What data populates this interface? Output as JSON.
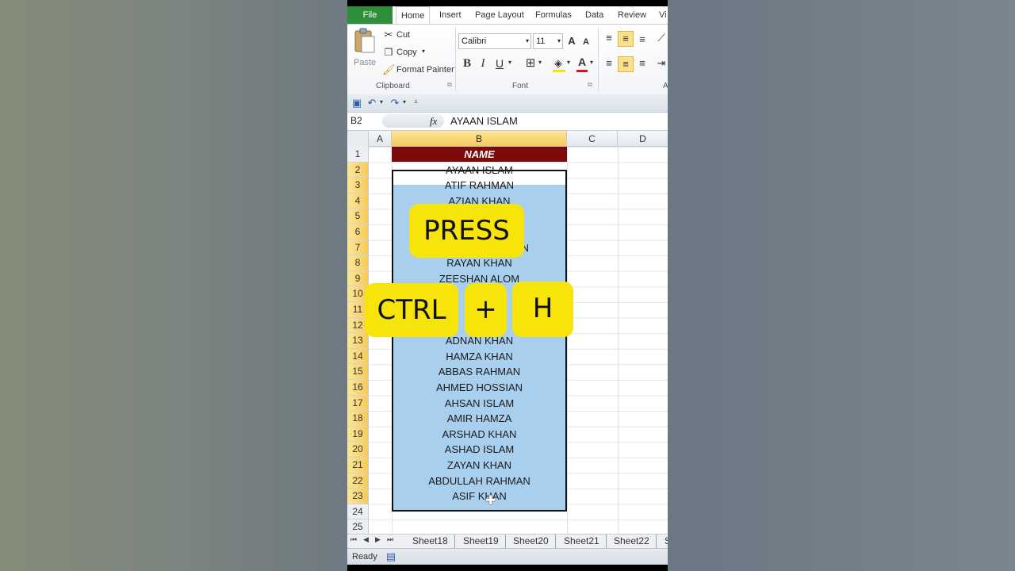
{
  "ribbon_tabs": [
    "File",
    "Home",
    "Insert",
    "Page Layout",
    "Formulas",
    "Data",
    "Review",
    "Vi"
  ],
  "clipboard": {
    "paste": "Paste",
    "cut": "Cut",
    "copy": "Copy",
    "format_painter": "Format Painter",
    "label": "Clipboard"
  },
  "font": {
    "name": "Calibri",
    "size": "11",
    "label": "Font",
    "bold": "B",
    "italic": "I",
    "underline": "U"
  },
  "alignment_label": "A",
  "formula_bar": {
    "cell_ref": "B2",
    "fx": "fx",
    "content": "AYAAN ISLAM"
  },
  "columns": [
    "A",
    "B",
    "C",
    "D"
  ],
  "rows": [
    "1",
    "2",
    "3",
    "4",
    "5",
    "6",
    "7",
    "8",
    "9",
    "10",
    "11",
    "12",
    "13",
    "14",
    "15",
    "16",
    "17",
    "18",
    "19",
    "20",
    "21",
    "22",
    "23",
    "24",
    "25"
  ],
  "header_cell": "NAME",
  "names": [
    "AYAAN ISLAM",
    "ATIF RAHMAN",
    "AZIAN KHAN",
    "",
    "",
    "N",
    "RAYAN KHAN",
    "ZEESHAN ALOM",
    "",
    "",
    "",
    "ADNAN KHAN",
    "HAMZA KHAN",
    "ABBAS RAHMAN",
    "AHMED HOSSIAN",
    "AHSAN ISLAM",
    "AMIR HAMZA",
    "ARSHAD KHAN",
    "ASHAD ISLAM",
    "ZAYAN KHAN",
    "ABDULLAH RAHMAN",
    "ASIF KHAN"
  ],
  "sheet_tabs": [
    "Sheet18",
    "Sheet19",
    "Sheet20",
    "Sheet21",
    "Sheet22",
    "S"
  ],
  "status": "Ready",
  "overlay": {
    "press": "PRESS",
    "ctrl": "CTRL",
    "plus": "+",
    "h": "H"
  },
  "colors": {
    "file_tab": "#2d8f3c",
    "header_fill": "#7e0b0b",
    "selection": "#a9cfee",
    "key_yellow": "#f7e40a"
  }
}
